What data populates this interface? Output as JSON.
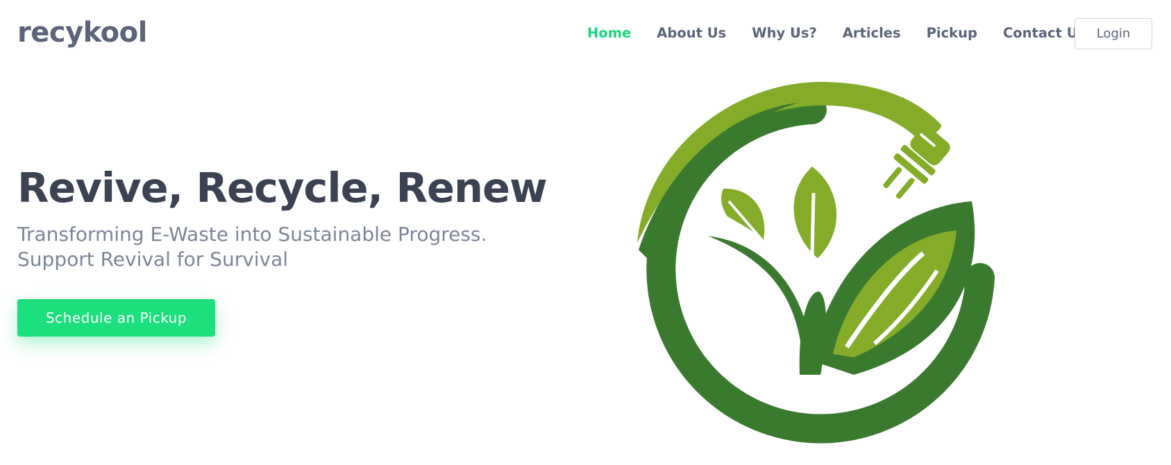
{
  "brand": {
    "name": "recykool"
  },
  "nav": {
    "items": [
      {
        "label": "Home",
        "active": true
      },
      {
        "label": "About Us",
        "active": false
      },
      {
        "label": "Why Us?",
        "active": false
      },
      {
        "label": "Articles",
        "active": false
      },
      {
        "label": "Pickup",
        "active": false
      },
      {
        "label": "Contact Us",
        "active": false
      }
    ],
    "login_label": "Login"
  },
  "hero": {
    "title": "Revive, Recycle, Renew",
    "subtitle_line1": "Transforming E-Waste into Sustainable Progress.",
    "subtitle_line2": "Support Revival for Survival",
    "cta_label": "Schedule an Pickup"
  },
  "colors": {
    "accent": "#1cd67c",
    "button": "#1be07d",
    "text_dark": "#3b4252",
    "text_muted": "#7c8597",
    "leaf_dark": "#3a7a2e",
    "leaf_light": "#84ac29"
  },
  "logo_icon": "eco-plug-leaf-icon"
}
